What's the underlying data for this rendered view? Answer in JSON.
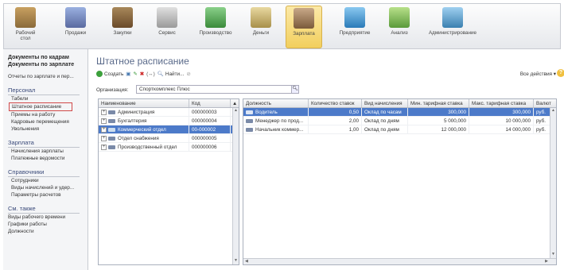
{
  "sections": [
    {
      "label": "Рабочий стол",
      "icon": "desktop-icon",
      "color": "#8a6a3a"
    },
    {
      "label": "Продажи",
      "icon": "sales-icon",
      "color": "#6a7ab0"
    },
    {
      "label": "Закупки",
      "icon": "purchases-icon",
      "color": "#7a5a3a"
    },
    {
      "label": "Сервис",
      "icon": "tools-icon",
      "color": "#9a9a9a"
    },
    {
      "label": "Производство",
      "icon": "factory-icon",
      "color": "#4a9a4a"
    },
    {
      "label": "Деньги",
      "icon": "money-icon",
      "color": "#b8a060"
    },
    {
      "label": "Зарплата",
      "icon": "salary-icon",
      "color": "#8a6a4a"
    },
    {
      "label": "Предприятие",
      "icon": "enterprise-icon",
      "color": "#3a8ac8"
    },
    {
      "label": "Анализ",
      "icon": "chart-icon",
      "color": "#6aa048"
    },
    {
      "label": "Администрирование",
      "icon": "admin-icon",
      "color": "#4a8ab0"
    }
  ],
  "sidebar": {
    "head1": "Документы по кадрам",
    "head2": "Документы по зарплате",
    "reports": "Отчеты по зарплате и пер...",
    "groups": [
      {
        "title": "Персонал",
        "items": [
          "Табели",
          "Штатное расписание",
          "Приемы на работу",
          "Кадровые перемещения",
          "Увольнения"
        ]
      },
      {
        "title": "Зарплата",
        "items": [
          "Начисления зарплаты",
          "Платежные ведомости"
        ]
      },
      {
        "title": "Справочники",
        "items": [
          "Сотрудники",
          "Виды начислений и удер...",
          "Параметры расчетов"
        ]
      }
    ],
    "see_also": {
      "title": "См. также",
      "items": [
        "Виды рабочего времени",
        "Графики работы",
        "Должности"
      ]
    }
  },
  "main": {
    "title": "Штатное расписание",
    "toolbar": {
      "create": "Создать",
      "find": "Найти...",
      "all_actions": "Все действия"
    },
    "org_label": "Организация:",
    "org_value": "Спорткомплекс Плюс",
    "tree": {
      "columns": [
        "Наименование",
        "Код"
      ],
      "rows": [
        {
          "name": "Администрация",
          "code": "000000003"
        },
        {
          "name": "Бухгалтерия",
          "code": "000000004"
        },
        {
          "name": "Коммерческий отдел",
          "code": "00-000002"
        },
        {
          "name": "Отдел снабжения",
          "code": "000000005"
        },
        {
          "name": "Производственный отдел",
          "code": "000000006"
        }
      ]
    },
    "grid": {
      "columns": [
        "Должность",
        "Количество ставок",
        "Вид начисления",
        "Мин. тарифная ставка",
        "Макс. тарифная ставка",
        "Валют"
      ],
      "rows": [
        {
          "pos": "Водитель",
          "count": "0,50",
          "kind": "Оклад по часам",
          "min": "300,000",
          "max": "300,000",
          "cur": "руб."
        },
        {
          "pos": "Менеджер по прод...",
          "count": "2,00",
          "kind": "Оклад по дням",
          "min": "5 000,000",
          "max": "10 000,000",
          "cur": "руб."
        },
        {
          "pos": "Начальник коммер...",
          "count": "1,00",
          "kind": "Оклад по дням",
          "min": "12 000,000",
          "max": "14 000,000",
          "cur": "руб."
        }
      ]
    }
  }
}
